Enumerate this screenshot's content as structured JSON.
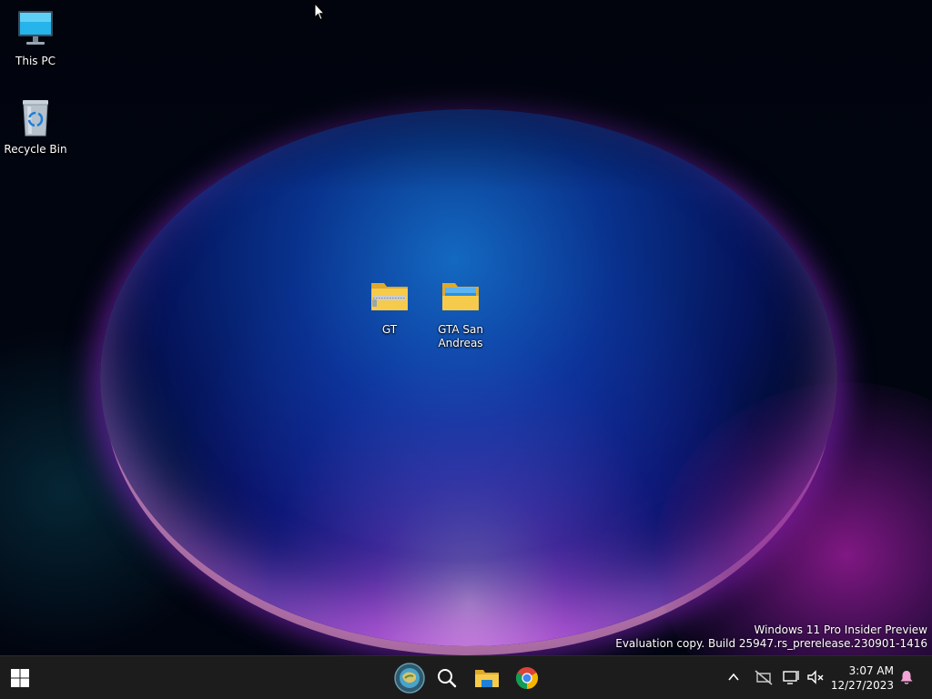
{
  "desktop": {
    "icons": [
      {
        "label": "This PC",
        "icon": "this-pc-icon"
      },
      {
        "label": "Recycle Bin",
        "icon": "recycle-bin-icon"
      },
      {
        "label": "GT",
        "icon": "zip-folder-icon"
      },
      {
        "label": "GTA San Andreas",
        "icon": "folder-icon"
      }
    ],
    "watermark": {
      "line1": "Windows 11 Pro Insider Preview",
      "line2": "Evaluation copy. Build 25947.rs_prerelease.230901-1416"
    }
  },
  "taskbar": {
    "start_icon": "windows-logo-icon",
    "pinned": [
      {
        "name": "widgets",
        "icon": "widgets-globe-icon"
      },
      {
        "name": "search",
        "icon": "search-icon"
      },
      {
        "name": "file-explorer",
        "icon": "file-explorer-icon"
      },
      {
        "name": "chrome",
        "icon": "chrome-icon"
      }
    ],
    "tray": {
      "icons": [
        "chevron-up-icon",
        "network-off-icon",
        "display-icon",
        "speaker-muted-icon"
      ],
      "time": "3:07 AM",
      "date": "12/27/2023",
      "notification_icon": "notification-bell-icon"
    }
  },
  "colors": {
    "taskbar_bg": "#1c1c1c",
    "folder_yellow": "#f4c542",
    "accent_blue": "#1a6fd6"
  }
}
